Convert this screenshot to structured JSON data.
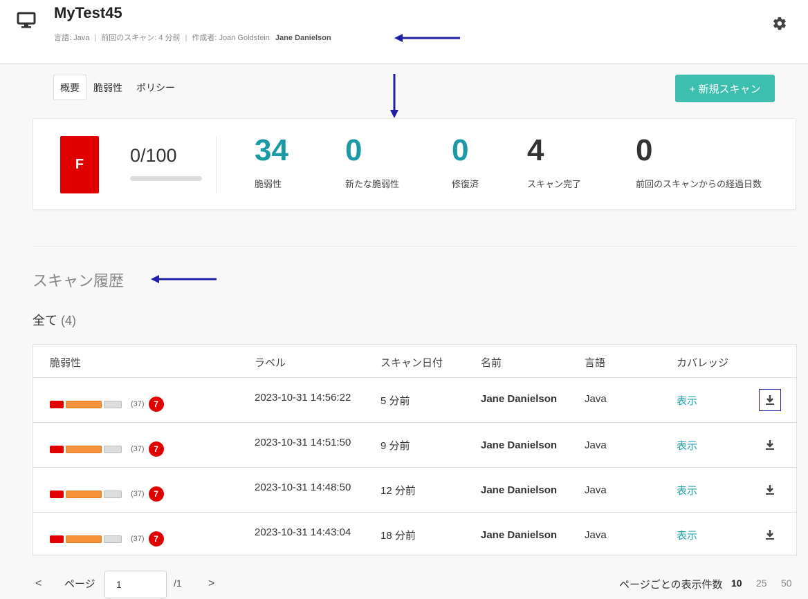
{
  "header": {
    "title": "MyTest45",
    "language_label": "言語: Java",
    "last_scan_label": "前回のスキャン: 4 分前",
    "created_by_label": "作成者: Joan Goldstein",
    "author": "Jane Danielson"
  },
  "tabs": [
    {
      "label": "概要",
      "active": true
    },
    {
      "label": "脆弱性",
      "active": false
    },
    {
      "label": "ポリシー",
      "active": false
    }
  ],
  "new_scan_button": "+ 新規スキャン",
  "summary": {
    "grade": "F",
    "score": "0/100",
    "score_fraction": 0,
    "stats": [
      {
        "value": "34",
        "label": "脆弱性"
      },
      {
        "value": "0",
        "label": "新たな脆弱性"
      },
      {
        "value": "0",
        "label": "修復済"
      },
      {
        "value": "4",
        "label": "スキャン完了"
      },
      {
        "value": "0",
        "label": "前回のスキャンからの経過日数"
      }
    ]
  },
  "history": {
    "title": "スキャン履歴",
    "filter_label": "全て",
    "filter_count": "(4)"
  },
  "table": {
    "columns": [
      "脆弱性",
      "ラベル",
      "スキャン日付",
      "名前",
      "言語",
      "カバレッジ"
    ],
    "rows": [
      {
        "vuln_count": "(37)",
        "badge": "7",
        "label": "2023-10-31 14:56:22",
        "date": "5 分前",
        "name": "Jane Danielson",
        "language": "Java",
        "coverage": "表示"
      },
      {
        "vuln_count": "(37)",
        "badge": "7",
        "label": "2023-10-31 14:51:50",
        "date": "9 分前",
        "name": "Jane Danielson",
        "language": "Java",
        "coverage": "表示"
      },
      {
        "vuln_count": "(37)",
        "badge": "7",
        "label": "2023-10-31 14:48:50",
        "date": "12 分前",
        "name": "Jane Danielson",
        "language": "Java",
        "coverage": "表示"
      },
      {
        "vuln_count": "(37)",
        "badge": "7",
        "label": "2023-10-31 14:43:04",
        "date": "18 分前",
        "name": "Jane Danielson",
        "language": "Java",
        "coverage": "表示"
      }
    ]
  },
  "pagination": {
    "prev": "<",
    "page_label": "ページ",
    "page_value": "1",
    "total": "/1",
    "next": ">",
    "per_page_label": "ページごとの表示件数",
    "per_page_options": [
      "10",
      "25",
      "50"
    ],
    "per_page_selected": "10"
  },
  "colors": {
    "accent": "#3cbfae",
    "teal_text": "#1b9aa6",
    "critical": "#e00000",
    "high": "#f7923a"
  }
}
